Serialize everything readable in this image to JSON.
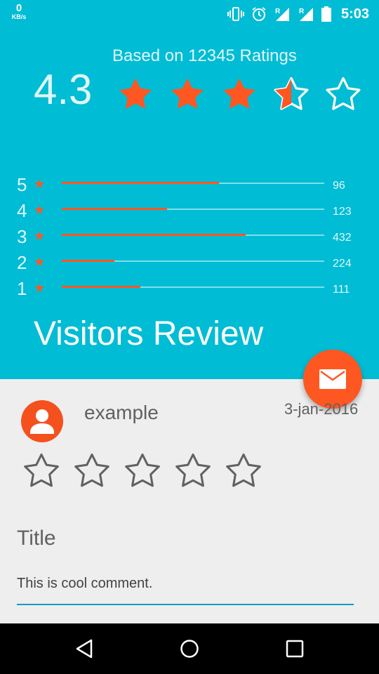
{
  "status_bar": {
    "network_speed": "0",
    "network_unit": "KB/s",
    "time": "5:03",
    "icons": [
      "vibrate-icon",
      "alarm-icon",
      "signal-r-icon",
      "signal-r-icon",
      "battery-icon"
    ]
  },
  "rating_summary": {
    "caption": "Based on 12345 Ratings",
    "average": "4.3",
    "stars_filled": 3.5,
    "stars_total": 5
  },
  "distribution": [
    {
      "stars": "5",
      "count": "96",
      "fill_fraction": 0.6
    },
    {
      "stars": "4",
      "count": "123",
      "fill_fraction": 0.4
    },
    {
      "stars": "3",
      "count": "432",
      "fill_fraction": 0.7
    },
    {
      "stars": "2",
      "count": "224",
      "fill_fraction": 0.2
    },
    {
      "stars": "1",
      "count": "111",
      "fill_fraction": 0.3
    }
  ],
  "section_title": "Visitors Review",
  "review": {
    "username": "example",
    "date": "3-jan-2016",
    "stars_filled": 0,
    "stars_total": 5,
    "title_label": "Title",
    "comment": "This is cool comment."
  },
  "colors": {
    "header_bg": "#00bcd4",
    "accent": "#ff5722",
    "body_bg": "#eeeeee"
  }
}
